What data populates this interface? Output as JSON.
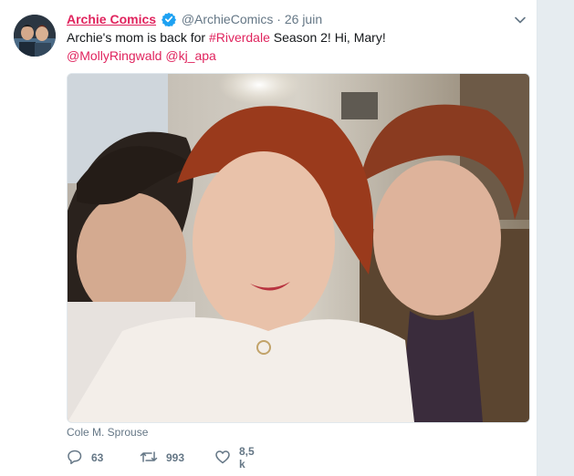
{
  "tweet": {
    "display_name": "Archie Comics",
    "handle": "@ArchieComics",
    "separator": "·",
    "date": "26 juin",
    "text_before": "Archie's mom is back for ",
    "hashtag": "#Riverdale",
    "text_after": " Season 2! Hi, Mary!",
    "mention_1": "@MollyRingwald",
    "mention_2": "@kj_apa",
    "photo_caption": "Cole M. Sprouse"
  },
  "actions": {
    "replies": "63",
    "retweets": "993",
    "likes": "8,5 k"
  },
  "colors": {
    "accent": "#e0245e",
    "muted": "#657786",
    "verified": "#1da1f2"
  },
  "icons": [
    "verified-badge-icon",
    "chevron-down-icon",
    "reply-icon",
    "retweet-icon",
    "like-icon"
  ]
}
